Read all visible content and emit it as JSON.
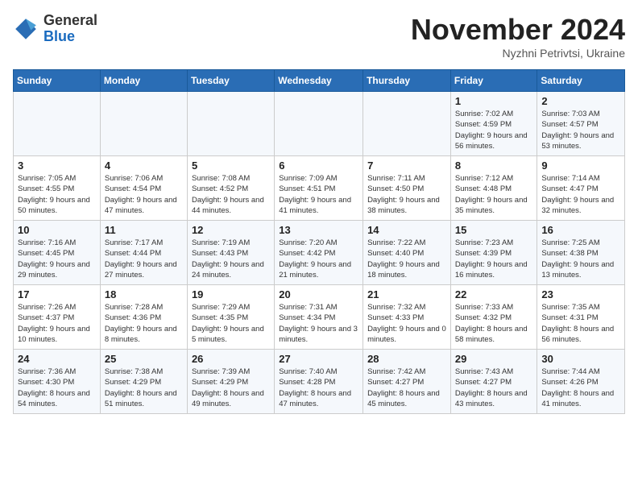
{
  "logo": {
    "general": "General",
    "blue": "Blue"
  },
  "title": "November 2024",
  "location": "Nyzhni Petrivtsi, Ukraine",
  "days_of_week": [
    "Sunday",
    "Monday",
    "Tuesday",
    "Wednesday",
    "Thursday",
    "Friday",
    "Saturday"
  ],
  "weeks": [
    [
      {
        "day": "",
        "info": ""
      },
      {
        "day": "",
        "info": ""
      },
      {
        "day": "",
        "info": ""
      },
      {
        "day": "",
        "info": ""
      },
      {
        "day": "",
        "info": ""
      },
      {
        "day": "1",
        "info": "Sunrise: 7:02 AM\nSunset: 4:59 PM\nDaylight: 9 hours and 56 minutes."
      },
      {
        "day": "2",
        "info": "Sunrise: 7:03 AM\nSunset: 4:57 PM\nDaylight: 9 hours and 53 minutes."
      }
    ],
    [
      {
        "day": "3",
        "info": "Sunrise: 7:05 AM\nSunset: 4:55 PM\nDaylight: 9 hours and 50 minutes."
      },
      {
        "day": "4",
        "info": "Sunrise: 7:06 AM\nSunset: 4:54 PM\nDaylight: 9 hours and 47 minutes."
      },
      {
        "day": "5",
        "info": "Sunrise: 7:08 AM\nSunset: 4:52 PM\nDaylight: 9 hours and 44 minutes."
      },
      {
        "day": "6",
        "info": "Sunrise: 7:09 AM\nSunset: 4:51 PM\nDaylight: 9 hours and 41 minutes."
      },
      {
        "day": "7",
        "info": "Sunrise: 7:11 AM\nSunset: 4:50 PM\nDaylight: 9 hours and 38 minutes."
      },
      {
        "day": "8",
        "info": "Sunrise: 7:12 AM\nSunset: 4:48 PM\nDaylight: 9 hours and 35 minutes."
      },
      {
        "day": "9",
        "info": "Sunrise: 7:14 AM\nSunset: 4:47 PM\nDaylight: 9 hours and 32 minutes."
      }
    ],
    [
      {
        "day": "10",
        "info": "Sunrise: 7:16 AM\nSunset: 4:45 PM\nDaylight: 9 hours and 29 minutes."
      },
      {
        "day": "11",
        "info": "Sunrise: 7:17 AM\nSunset: 4:44 PM\nDaylight: 9 hours and 27 minutes."
      },
      {
        "day": "12",
        "info": "Sunrise: 7:19 AM\nSunset: 4:43 PM\nDaylight: 9 hours and 24 minutes."
      },
      {
        "day": "13",
        "info": "Sunrise: 7:20 AM\nSunset: 4:42 PM\nDaylight: 9 hours and 21 minutes."
      },
      {
        "day": "14",
        "info": "Sunrise: 7:22 AM\nSunset: 4:40 PM\nDaylight: 9 hours and 18 minutes."
      },
      {
        "day": "15",
        "info": "Sunrise: 7:23 AM\nSunset: 4:39 PM\nDaylight: 9 hours and 16 minutes."
      },
      {
        "day": "16",
        "info": "Sunrise: 7:25 AM\nSunset: 4:38 PM\nDaylight: 9 hours and 13 minutes."
      }
    ],
    [
      {
        "day": "17",
        "info": "Sunrise: 7:26 AM\nSunset: 4:37 PM\nDaylight: 9 hours and 10 minutes."
      },
      {
        "day": "18",
        "info": "Sunrise: 7:28 AM\nSunset: 4:36 PM\nDaylight: 9 hours and 8 minutes."
      },
      {
        "day": "19",
        "info": "Sunrise: 7:29 AM\nSunset: 4:35 PM\nDaylight: 9 hours and 5 minutes."
      },
      {
        "day": "20",
        "info": "Sunrise: 7:31 AM\nSunset: 4:34 PM\nDaylight: 9 hours and 3 minutes."
      },
      {
        "day": "21",
        "info": "Sunrise: 7:32 AM\nSunset: 4:33 PM\nDaylight: 9 hours and 0 minutes."
      },
      {
        "day": "22",
        "info": "Sunrise: 7:33 AM\nSunset: 4:32 PM\nDaylight: 8 hours and 58 minutes."
      },
      {
        "day": "23",
        "info": "Sunrise: 7:35 AM\nSunset: 4:31 PM\nDaylight: 8 hours and 56 minutes."
      }
    ],
    [
      {
        "day": "24",
        "info": "Sunrise: 7:36 AM\nSunset: 4:30 PM\nDaylight: 8 hours and 54 minutes."
      },
      {
        "day": "25",
        "info": "Sunrise: 7:38 AM\nSunset: 4:29 PM\nDaylight: 8 hours and 51 minutes."
      },
      {
        "day": "26",
        "info": "Sunrise: 7:39 AM\nSunset: 4:29 PM\nDaylight: 8 hours and 49 minutes."
      },
      {
        "day": "27",
        "info": "Sunrise: 7:40 AM\nSunset: 4:28 PM\nDaylight: 8 hours and 47 minutes."
      },
      {
        "day": "28",
        "info": "Sunrise: 7:42 AM\nSunset: 4:27 PM\nDaylight: 8 hours and 45 minutes."
      },
      {
        "day": "29",
        "info": "Sunrise: 7:43 AM\nSunset: 4:27 PM\nDaylight: 8 hours and 43 minutes."
      },
      {
        "day": "30",
        "info": "Sunrise: 7:44 AM\nSunset: 4:26 PM\nDaylight: 8 hours and 41 minutes."
      }
    ]
  ]
}
